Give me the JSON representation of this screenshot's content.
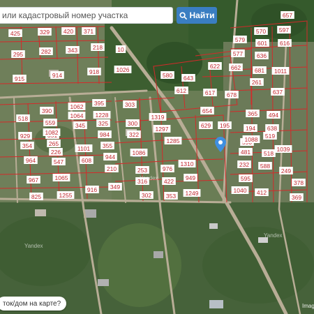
{
  "search": {
    "placeholder": "или кадастровый номер участка",
    "button_label": "Найти"
  },
  "bottom_prompt": "ток/дом на карте?",
  "attribution": "Image",
  "map_watermark": "Yandex",
  "map_marker": "location-pin",
  "colors": {
    "parcel_border": "#d42a2a",
    "label_bg": "#ffffff",
    "label_text": "#c0272d",
    "button": "#3a7ec2",
    "pin": "#3f8fe0"
  },
  "parcel_labels": [
    "425",
    "329",
    "420",
    "371",
    "295",
    "282",
    "343",
    "218",
    "10",
    "915",
    "914",
    "918",
    "1026",
    "303",
    "580",
    "643",
    "612",
    "622",
    "662",
    "617",
    "678",
    "579",
    "577",
    "636",
    "601",
    "681",
    "1011",
    "261",
    "637",
    "597",
    "616",
    "657",
    "570",
    "654",
    "365",
    "494",
    "629",
    "195",
    "194",
    "638",
    "590",
    "1310",
    "518",
    "390",
    "1062",
    "395",
    "1228",
    "1064",
    "559",
    "351",
    "345",
    "929",
    "1082",
    "325",
    "984",
    "300",
    "1319",
    "322",
    "1297",
    "354",
    "265",
    "1101",
    "355",
    "1086",
    "964",
    "226",
    "547",
    "608",
    "944",
    "1285",
    "967",
    "1065",
    "210",
    "253",
    "976",
    "949",
    "916",
    "349",
    "316",
    "422",
    "825",
    "1255",
    "302",
    "353",
    "1249",
    "1040",
    "412",
    "369",
    "378",
    "249",
    "481",
    "518",
    "232",
    "588",
    "595",
    "519",
    "1088",
    "1039"
  ]
}
